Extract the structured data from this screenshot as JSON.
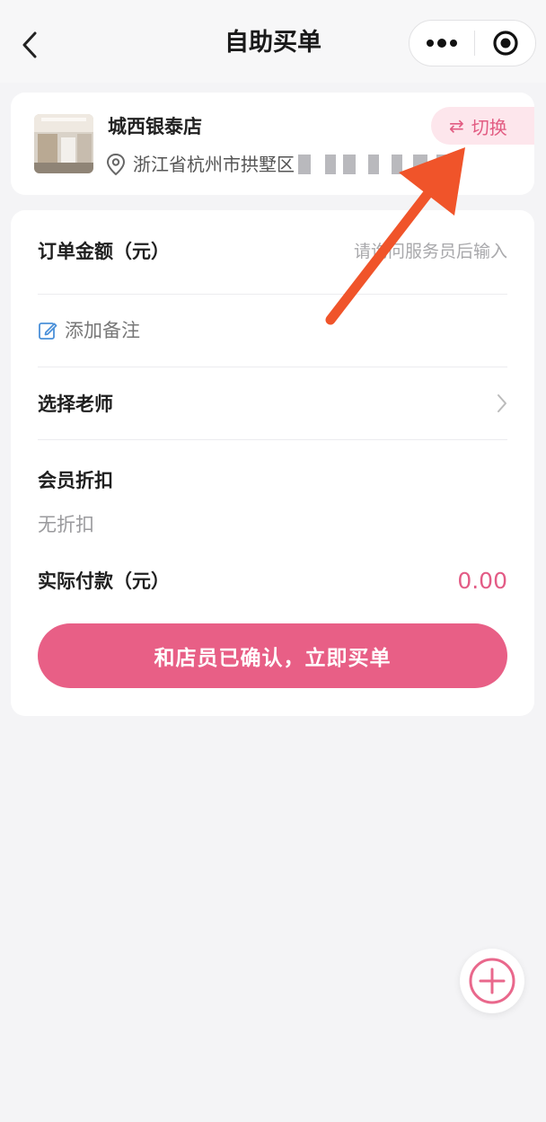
{
  "header": {
    "title": "自助买单",
    "back_icon": "chevron-left-icon",
    "more_icon": "more-dots-icon",
    "close_icon": "target-close-icon"
  },
  "store": {
    "name": "城西银泰店",
    "address": "浙江省杭州市拱墅区",
    "switch_label": "切换",
    "switch_icon": "swap-arrows-icon",
    "location_icon": "map-pin-icon"
  },
  "form": {
    "amount_label": "订单金额（元）",
    "amount_placeholder": "请询问服务员后输入",
    "note_label": "添加备注",
    "teacher_label": "选择老师",
    "discount_label": "会员折扣",
    "discount_value": "无折扣",
    "pay_label": "实际付款（元）",
    "pay_value": "0.00",
    "confirm_button": "和店员已确认，立即买单"
  },
  "colors": {
    "accent": "#e85f86",
    "accent_light": "#fde6ec",
    "annotation_arrow": "#f0542a",
    "background": "#f4f4f6"
  }
}
